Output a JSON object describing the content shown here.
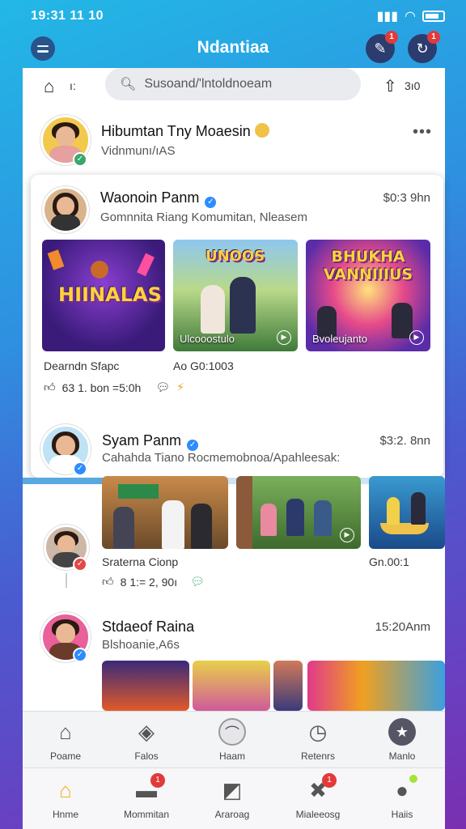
{
  "status": {
    "time": "19:31 11 10"
  },
  "app": {
    "title": "Ndantiaa",
    "notif_badge_1": "1",
    "notif_badge_2": "1"
  },
  "search": {
    "home_label": "ı:",
    "placeholder": "Susoand/'lntoldnoeam",
    "share_label": "3ı0"
  },
  "header_post": {
    "name": "Hibumtan Tny Moaesin",
    "sub": "Vidnmunı/ıAS"
  },
  "post1": {
    "name": "Waonoin Panm",
    "time": "$0:3 9hn",
    "sub": "Gomnnita Riang Komumitan, Nleasem",
    "thumbs": [
      {
        "title": "HIINALAS",
        "caption": ""
      },
      {
        "title": "UNOOS",
        "caption": "Ulcooostulo"
      },
      {
        "title": "BHUKHA VANNIIIUS",
        "caption": "Bvoleujanto"
      }
    ],
    "meta_left": "Dearndn Sfapc",
    "meta_right": "Ao G0:1003",
    "reactions": "63 1. bon =5:0h"
  },
  "post2": {
    "name": "Syam Panm",
    "time": "$3:2. 8nn",
    "sub": "Cahahda Tiano Rocmemobnoa/Apahleesak:",
    "meta_left": "Sraterna Cionp",
    "meta_right": "Gn.00:1",
    "reactions": "8 1:= 2, 90ı"
  },
  "post3": {
    "name": "Stdaeof Raina",
    "time": "15:20Anm",
    "sub": "Blshoanie,A6s"
  },
  "feed_progress": 0.41,
  "nav_top": [
    {
      "label": "Poame",
      "icon": "home-icon"
    },
    {
      "label": "Falos",
      "icon": "map-icon"
    },
    {
      "label": "Haam",
      "icon": "chat-icon"
    },
    {
      "label": "Retenrs",
      "icon": "clock-icon"
    },
    {
      "label": "Manlo",
      "icon": "star-icon"
    }
  ],
  "nav_bottom": [
    {
      "label": "Hnme",
      "icon": "home-icon",
      "badge": ""
    },
    {
      "label": "Mommitan",
      "icon": "people-icon",
      "badge": "1"
    },
    {
      "label": "Araroag",
      "icon": "image-icon",
      "badge": ""
    },
    {
      "label": "Mialeeosg",
      "icon": "user-icon",
      "badge": "1"
    },
    {
      "label": "Haiis",
      "icon": "profile-icon",
      "badge": ""
    }
  ],
  "colors": {
    "accent": "#2d8cff",
    "badge": "#e23a3a"
  }
}
